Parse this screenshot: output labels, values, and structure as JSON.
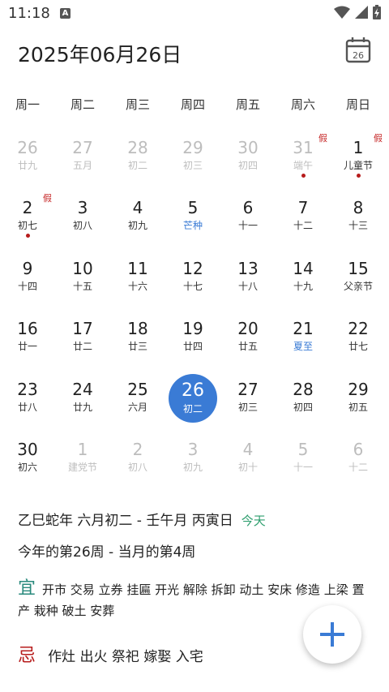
{
  "status": {
    "time": "11:18",
    "notif": "A"
  },
  "header": {
    "date": "2025年06月26日",
    "today_icon_day": "26"
  },
  "weekdays": [
    "周一",
    "周二",
    "周三",
    "周四",
    "周五",
    "周六",
    "周日"
  ],
  "weeks": [
    [
      {
        "d": "26",
        "l": "廿九",
        "other": true
      },
      {
        "d": "27",
        "l": "五月",
        "other": true
      },
      {
        "d": "28",
        "l": "初二",
        "other": true
      },
      {
        "d": "29",
        "l": "初三",
        "other": true
      },
      {
        "d": "30",
        "l": "初四",
        "other": true
      },
      {
        "d": "31",
        "l": "端午",
        "other": true,
        "hol": "假",
        "dot": true
      },
      {
        "d": "1",
        "l": "儿童节",
        "hol": "假",
        "dot": true
      }
    ],
    [
      {
        "d": "2",
        "l": "初七",
        "hol": "假",
        "dot": true
      },
      {
        "d": "3",
        "l": "初八"
      },
      {
        "d": "4",
        "l": "初九"
      },
      {
        "d": "5",
        "l": "芒种",
        "term": true
      },
      {
        "d": "6",
        "l": "十一"
      },
      {
        "d": "7",
        "l": "十二"
      },
      {
        "d": "8",
        "l": "十三"
      }
    ],
    [
      {
        "d": "9",
        "l": "十四"
      },
      {
        "d": "10",
        "l": "十五"
      },
      {
        "d": "11",
        "l": "十六"
      },
      {
        "d": "12",
        "l": "十七"
      },
      {
        "d": "13",
        "l": "十八"
      },
      {
        "d": "14",
        "l": "十九"
      },
      {
        "d": "15",
        "l": "父亲节"
      }
    ],
    [
      {
        "d": "16",
        "l": "廿一"
      },
      {
        "d": "17",
        "l": "廿二"
      },
      {
        "d": "18",
        "l": "廿三"
      },
      {
        "d": "19",
        "l": "廿四"
      },
      {
        "d": "20",
        "l": "廿五"
      },
      {
        "d": "21",
        "l": "夏至",
        "term": true
      },
      {
        "d": "22",
        "l": "廿七"
      }
    ],
    [
      {
        "d": "23",
        "l": "廿八"
      },
      {
        "d": "24",
        "l": "廿九"
      },
      {
        "d": "25",
        "l": "六月"
      },
      {
        "d": "26",
        "l": "初二",
        "selected": true
      },
      {
        "d": "27",
        "l": "初三"
      },
      {
        "d": "28",
        "l": "初四"
      },
      {
        "d": "29",
        "l": "初五"
      }
    ],
    [
      {
        "d": "30",
        "l": "初六"
      },
      {
        "d": "1",
        "l": "建党节",
        "other": true
      },
      {
        "d": "2",
        "l": "初八",
        "other": true
      },
      {
        "d": "3",
        "l": "初九",
        "other": true
      },
      {
        "d": "4",
        "l": "初十",
        "other": true
      },
      {
        "d": "5",
        "l": "十一",
        "other": true
      },
      {
        "d": "6",
        "l": "十二",
        "other": true
      }
    ]
  ],
  "info": {
    "ganzhi": "乙巳蛇年 六月初二 - 壬午月 丙寅日",
    "today_label": "今天",
    "week_info": "今年的第26周 - 当月的第4周"
  },
  "yi": {
    "label": "宜",
    "items": "开市 交易 立券 挂匾 开光 解除 拆卸 动土 安床 修造 上梁 置产 栽种 破土 安葬"
  },
  "ji": {
    "label": "忌",
    "items": "作灶 出火 祭祀 嫁娶 入宅"
  },
  "colors": {
    "accent": "#3a7bd5",
    "holiday": "#c62828",
    "yi": "#2a8a7d",
    "ji": "#b71c1c"
  }
}
